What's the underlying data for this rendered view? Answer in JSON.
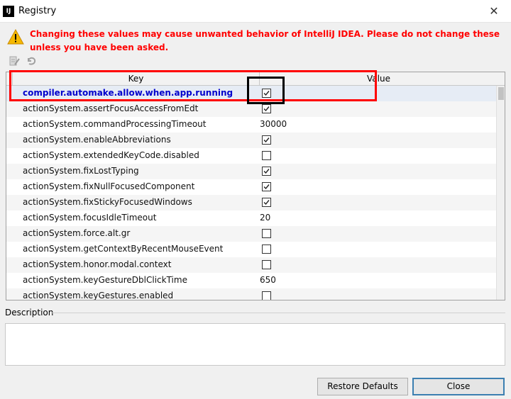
{
  "window": {
    "title": "Registry",
    "app_icon": "IJ",
    "close_glyph": "✕"
  },
  "warning": {
    "icon": "warning-triangle-icon",
    "text": "Changing these values may cause unwanted behavior of IntelliJ IDEA. Please do not change these unless you have been asked."
  },
  "toolbar": {
    "icons": [
      "edit-icon",
      "restore-icon"
    ]
  },
  "table": {
    "columns": {
      "key": "Key",
      "value": "Value"
    },
    "rows": [
      {
        "key": "compiler.automake.allow.when.app.running",
        "value": "",
        "type": "checkbox",
        "checked": true,
        "selected": true
      },
      {
        "key": "actionSystem.assertFocusAccessFromEdt",
        "value": "",
        "type": "checkbox",
        "checked": true
      },
      {
        "key": "actionSystem.commandProcessingTimeout",
        "value": "30000",
        "type": "text"
      },
      {
        "key": "actionSystem.enableAbbreviations",
        "value": "",
        "type": "checkbox",
        "checked": true
      },
      {
        "key": "actionSystem.extendedKeyCode.disabled",
        "value": "",
        "type": "checkbox",
        "checked": false
      },
      {
        "key": "actionSystem.fixLostTyping",
        "value": "",
        "type": "checkbox",
        "checked": true
      },
      {
        "key": "actionSystem.fixNullFocusedComponent",
        "value": "",
        "type": "checkbox",
        "checked": true
      },
      {
        "key": "actionSystem.fixStickyFocusedWindows",
        "value": "",
        "type": "checkbox",
        "checked": true
      },
      {
        "key": "actionSystem.focusIdleTimeout",
        "value": "20",
        "type": "text"
      },
      {
        "key": "actionSystem.force.alt.gr",
        "value": "",
        "type": "checkbox",
        "checked": false
      },
      {
        "key": "actionSystem.getContextByRecentMouseEvent",
        "value": "",
        "type": "checkbox",
        "checked": false
      },
      {
        "key": "actionSystem.honor.modal.context",
        "value": "",
        "type": "checkbox",
        "checked": false
      },
      {
        "key": "actionSystem.keyGestureDblClickTime",
        "value": "650",
        "type": "text"
      },
      {
        "key": "actionSystem.keyGestures.enabled",
        "value": "",
        "type": "checkbox",
        "checked": false
      }
    ]
  },
  "description": {
    "label": "Description",
    "text": ""
  },
  "buttons": {
    "restore": "Restore Defaults",
    "close": "Close"
  },
  "colors": {
    "warning": "#ff0000",
    "selected_key": "#0000cc",
    "highlight_red": "#ff0000",
    "highlight_black": "#000000"
  }
}
